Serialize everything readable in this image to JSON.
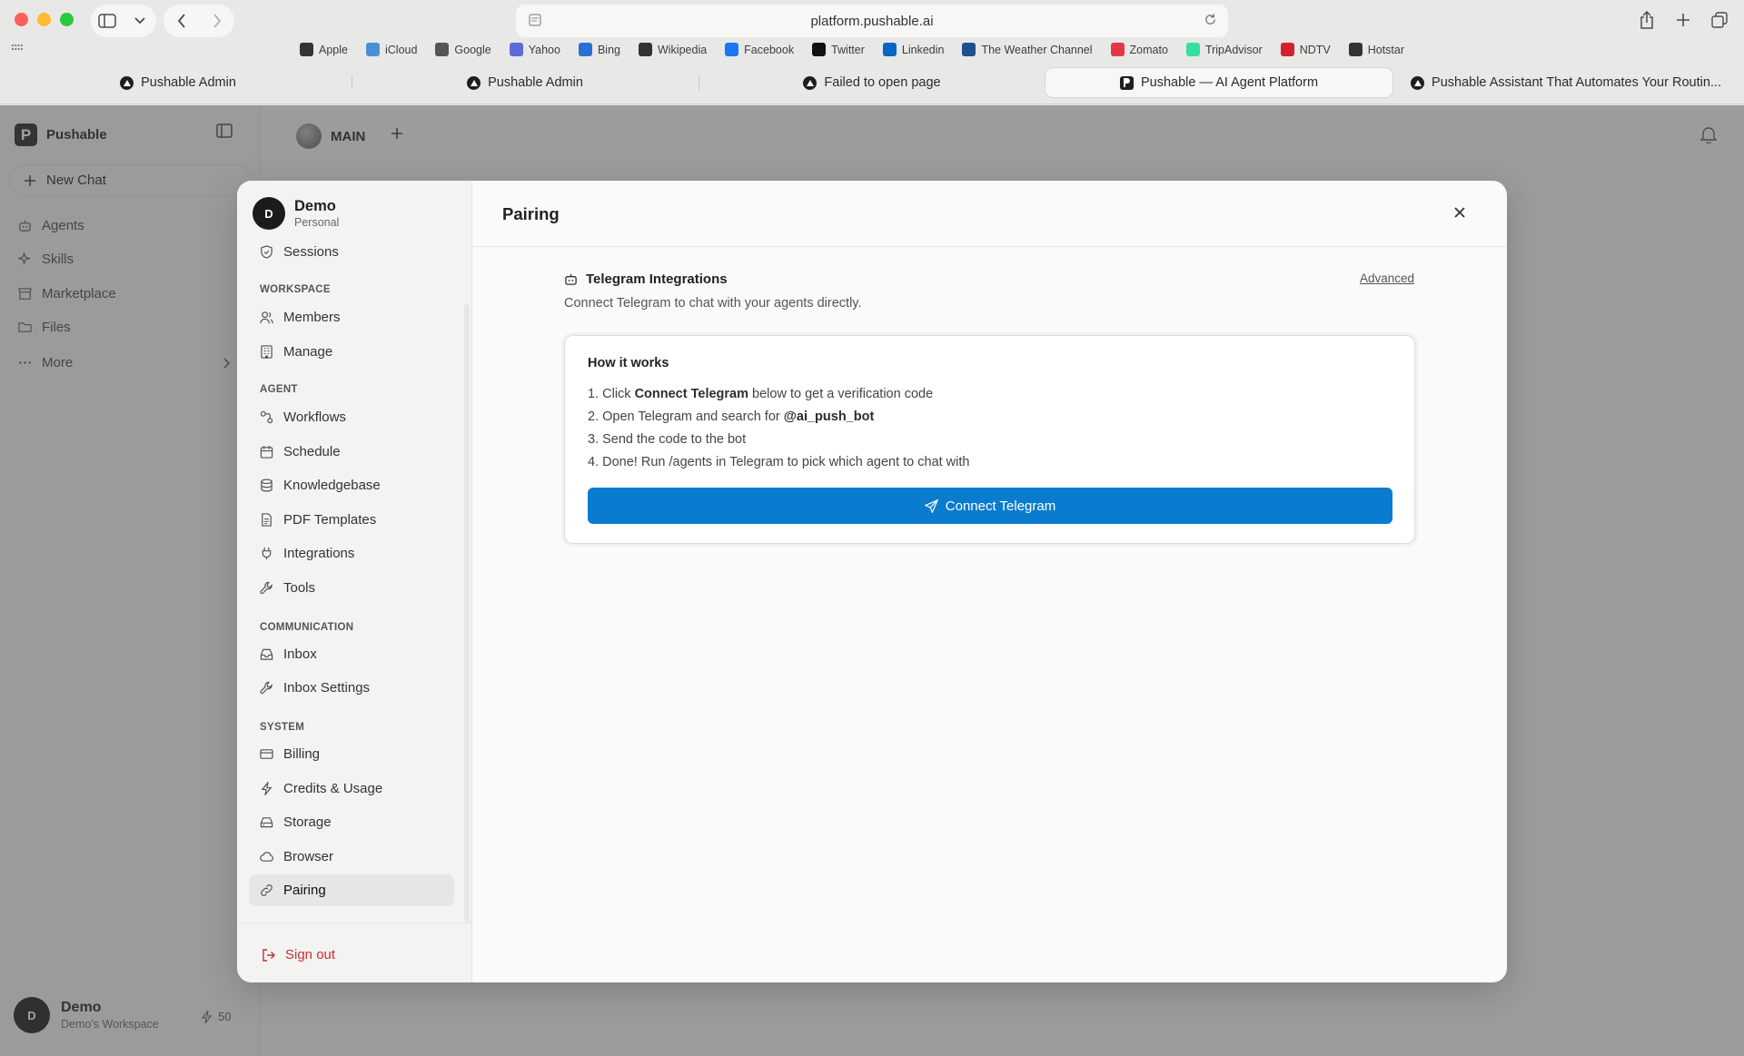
{
  "browser": {
    "url": "platform.pushable.ai",
    "favorites": [
      {
        "label": "Apple",
        "icon": "apple-icon",
        "color": "#333333"
      },
      {
        "label": "iCloud",
        "icon": "cloud-icon",
        "color": "#4a90d9"
      },
      {
        "label": "Google",
        "icon": "google-icon",
        "color": "#555555"
      },
      {
        "label": "Yahoo",
        "icon": "yahoo-icon",
        "color": "#5b6cd9"
      },
      {
        "label": "Bing",
        "icon": "search-icon",
        "color": "#2b6fd6"
      },
      {
        "label": "Wikipedia",
        "icon": "wikipedia-icon",
        "color": "#333333"
      },
      {
        "label": "Facebook",
        "icon": "facebook-icon",
        "color": "#1877f2"
      },
      {
        "label": "Twitter",
        "icon": "x-icon",
        "color": "#111111"
      },
      {
        "label": "Linkedin",
        "icon": "linkedin-icon",
        "color": "#0a66c2"
      },
      {
        "label": "The Weather Channel",
        "icon": "weather-icon",
        "color": "#1d4f91"
      },
      {
        "label": "Zomato",
        "icon": "zomato-icon",
        "color": "#e23744"
      },
      {
        "label": "TripAdvisor",
        "icon": "tripadvisor-icon",
        "color": "#34e0a1"
      },
      {
        "label": "NDTV",
        "icon": "ndtv-icon",
        "color": "#d3202f"
      },
      {
        "label": "Hotstar",
        "icon": "hotstar-icon",
        "color": "#333333"
      }
    ],
    "tabs": [
      {
        "label": "Pushable Admin",
        "active": false
      },
      {
        "label": "Pushable Admin",
        "active": false
      },
      {
        "label": "Failed to open page",
        "active": false
      },
      {
        "label": "Pushable — AI Agent Platform",
        "active": true
      },
      {
        "label": "Pushable Assistant That Automates Your Routin...",
        "active": false
      }
    ]
  },
  "app": {
    "brand": "Pushable",
    "new_chat": "New Chat",
    "nav": [
      "Agents",
      "Skills",
      "Marketplace",
      "Files",
      "More"
    ],
    "workspace_tab": "MAIN",
    "user": {
      "name": "Demo",
      "workspace": "Demo's Workspace",
      "initial": "D",
      "credits": "50"
    }
  },
  "settings": {
    "org_name": "Demo",
    "org_type": "Personal",
    "org_initial": "D",
    "sessions": "Sessions",
    "sections": {
      "workspace": "WORKSPACE",
      "agent": "AGENT",
      "communication": "COMMUNICATION",
      "system": "SYSTEM"
    },
    "items": {
      "members": "Members",
      "manage": "Manage",
      "workflows": "Workflows",
      "schedule": "Schedule",
      "knowledgebase": "Knowledgebase",
      "pdf_templates": "PDF Templates",
      "integrations": "Integrations",
      "tools": "Tools",
      "inbox": "Inbox",
      "inbox_settings": "Inbox Settings",
      "billing": "Billing",
      "credits_usage": "Credits & Usage",
      "storage": "Storage",
      "browser": "Browser",
      "pairing": "Pairing"
    },
    "sign_out": "Sign out"
  },
  "pairing": {
    "title": "Pairing",
    "integration_title": "Telegram Integrations",
    "integration_desc": "Connect Telegram to chat with your agents directly.",
    "advanced": "Advanced",
    "how_title": "How it works",
    "steps": [
      {
        "pre": "1. Click ",
        "bold": "Connect Telegram",
        "post": " below to get a verification code"
      },
      {
        "pre": "2. Open Telegram and search for ",
        "bold": "@ai_push_bot",
        "post": ""
      },
      {
        "pre": "3. Send the code to the bot",
        "bold": "",
        "post": ""
      },
      {
        "pre": "4. Done! Run /agents in Telegram to pick which agent to chat with",
        "bold": "",
        "post": ""
      }
    ],
    "connect_button": "Connect Telegram",
    "accent": "#0a7ccf"
  }
}
